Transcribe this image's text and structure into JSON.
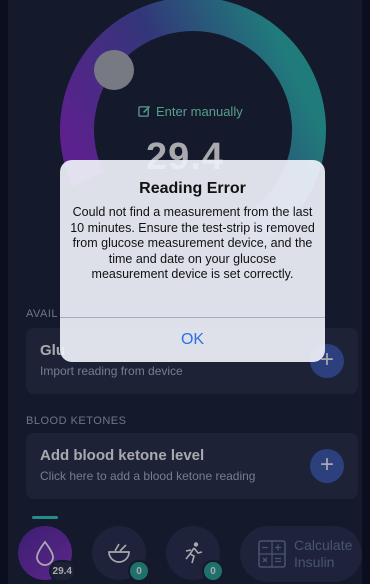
{
  "gauge": {
    "enter_manually_label": "Enter manually",
    "value": "29.4"
  },
  "sections": {
    "glucose_label": "AVAIL",
    "glucose_card": {
      "title": "Glu",
      "subtitle": "Import reading from device",
      "action": "+"
    },
    "ketones_label": "BLOOD KETONES",
    "ketones_card": {
      "title": "Add blood ketone level",
      "subtitle": "Click here to add a blood ketone reading",
      "action": "+"
    }
  },
  "bottom_nav": {
    "items": [
      {
        "icon": "drop-icon",
        "badge": "29.4",
        "active": true
      },
      {
        "icon": "food-bowl-icon",
        "badge": "0",
        "active": false
      },
      {
        "icon": "running-icon",
        "badge": "0",
        "active": false
      }
    ],
    "calculate_line1": "Calculate",
    "calculate_line2": "Insulin",
    "calculate_icon": "calculator-icon"
  },
  "dialog": {
    "title": "Reading Error",
    "message": "Could not find a measurement from the last 10 minutes. Ensure the test-strip is removed from glucose measurement device, and the time and date on your glucose measurement device is set correctly.",
    "ok_label": "OK"
  },
  "colors": {
    "background": "#1d2238",
    "accent_teal": "#36d3c6",
    "accent_purple": "#7a35c4",
    "dialog_button": "#2f6fe6"
  }
}
